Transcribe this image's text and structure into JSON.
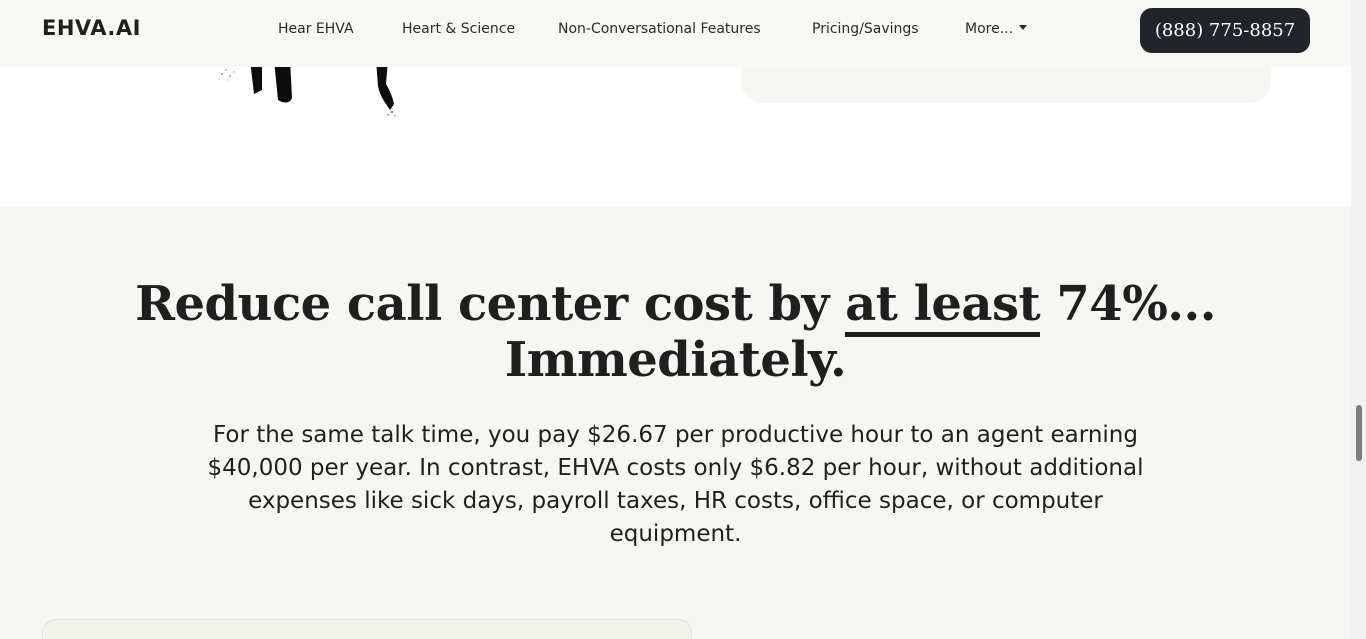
{
  "navbar": {
    "brand": "EHVA.AI",
    "links": [
      {
        "label": "Hear EHVA"
      },
      {
        "label": "Heart & Science"
      },
      {
        "label": "Non-Conversational Features"
      },
      {
        "label": "Pricing/Savings"
      },
      {
        "label": "More..."
      }
    ],
    "phone": "(888) 775-8857"
  },
  "hero": {
    "headline_part1": "Reduce call center cost by ",
    "headline_emphasis": "at least",
    "headline_part2": " 74%...",
    "headline_line2": "Immediately.",
    "body": "For the same talk time, you pay $26.67 per productive hour to an agent earning $40,000 per year. In contrast, EHVA costs only $6.82 per hour, without additional expenses like sick days, payroll taxes, HR costs, office space, or computer equipment."
  },
  "colors": {
    "accent_dark": "#212529",
    "page_background": "#f6f6f2",
    "navbar_background": "#f8f8f4"
  },
  "icons": {
    "dropdown": "caret-down-icon"
  }
}
